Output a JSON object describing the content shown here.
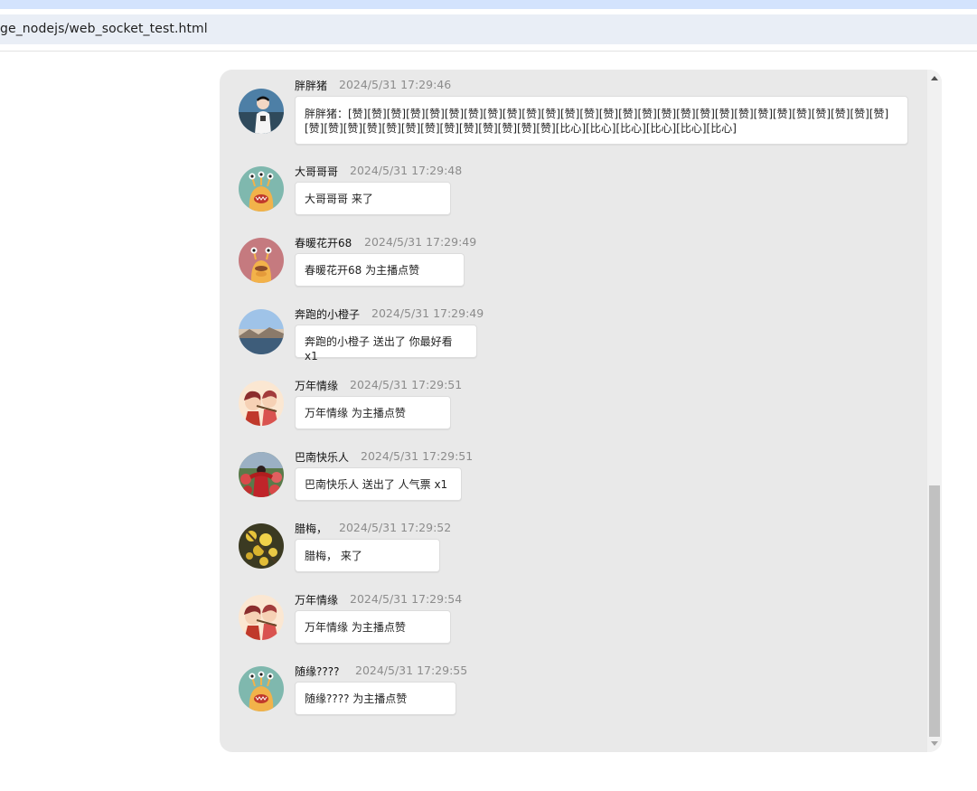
{
  "browser": {
    "url_text": "ge_nodejs/web_socket_test.html"
  },
  "messages": [
    {
      "name": "胖胖猪",
      "time": "2024/5/31 17:29:46",
      "text": "胖胖猪：[赞][赞][赞][赞][赞][赞][赞][赞][赞][赞][赞][赞][赞][赞][赞][赞][赞][赞][赞][赞][赞][赞][赞][赞][赞][赞][赞][赞][赞][赞][赞][赞][赞][赞][赞][赞][赞][赞][赞][赞][赞][比心][比心][比心][比心][比心][比心]",
      "avatar_icon": "portrait-photo"
    },
    {
      "name": "大哥哥哥",
      "time": "2024/5/31 17:29:48",
      "text": "大哥哥哥 来了",
      "avatar_icon": "monster-default"
    },
    {
      "name": "春暖花开68",
      "time": "2024/5/31 17:29:49",
      "text": "春暖花开68 为主播点赞",
      "avatar_icon": "monster-pink"
    },
    {
      "name": "奔跑的小橙子",
      "time": "2024/5/31 17:29:49",
      "text": "奔跑的小橙子 送出了 你最好看 x1",
      "avatar_icon": "landscape-photo"
    },
    {
      "name": "万年情缘",
      "time": "2024/5/31 17:29:51",
      "text": "万年情缘 为主播点赞",
      "avatar_icon": "couple-cartoon"
    },
    {
      "name": "巴南快乐人",
      "time": "2024/5/31 17:29:51",
      "text": "巴南快乐人 送出了 人气票 x1",
      "avatar_icon": "flower-person-photo"
    },
    {
      "name": "腊梅，",
      "time": "2024/5/31 17:29:52",
      "text": "腊梅， 来了",
      "avatar_icon": "yellow-flowers-photo"
    },
    {
      "name": "万年情缘",
      "time": "2024/5/31 17:29:54",
      "text": "万年情缘 为主播点赞",
      "avatar_icon": "couple-cartoon"
    },
    {
      "name": "随缘????",
      "time": "2024/5/31 17:29:55",
      "text": "随缘???? 为主播点赞",
      "avatar_icon": "monster-default"
    }
  ],
  "colors": {
    "panel_bg": "#e9e9e9",
    "bubble_bg": "#ffffff",
    "time_text": "#8c8c8c",
    "monster_teal": "#7fb8ae",
    "monster_pink": "#c57a7f",
    "monster_body": "#f2b24a"
  }
}
